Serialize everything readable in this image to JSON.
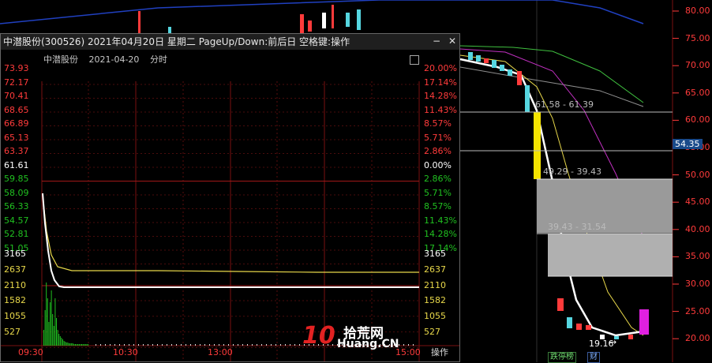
{
  "window": {
    "title": "中潜股份(300526) 2021年04月20日 星期二 PageUp/Down:前后日 空格键:操作",
    "minimize": "−",
    "close": "✕"
  },
  "intraday": {
    "name": "中潜股份",
    "date": "2021-04-20",
    "mode": "分时",
    "price_ticks": [
      "73.93",
      "72.17",
      "70.41",
      "68.65",
      "66.89",
      "65.13",
      "63.37",
      "61.61",
      "59.85",
      "58.09",
      "56.33",
      "54.57",
      "52.81",
      "51.05"
    ],
    "pct_ticks": [
      "20.00%",
      "17.14%",
      "14.28%",
      "11.43%",
      "8.57%",
      "5.71%",
      "2.86%",
      "0.00%",
      "2.86%",
      "5.71%",
      "8.57%",
      "11.43%",
      "14.28%",
      "17.14%"
    ],
    "volume_ticks": [
      "3165",
      "2637",
      "2110",
      "1582",
      "1055",
      "527"
    ],
    "time_ticks": [
      "09:30",
      "10:30",
      "13:00",
      "15:00"
    ],
    "ops_label": "操作"
  },
  "daily": {
    "price_axis": [
      "80.00",
      "75.00",
      "70.00",
      "65.00",
      "60.00",
      "55.00",
      "50.00",
      "45.00",
      "40.00",
      "35.00",
      "30.00",
      "25.00",
      "20.00"
    ],
    "current_price": "54.35",
    "zones": [
      {
        "label": "61.58 - 61.39"
      },
      {
        "label": "49.29 - 39.43"
      },
      {
        "label": "39.43 - 31.54"
      }
    ],
    "low_label": "19.16",
    "badges": [
      {
        "text": "跌停榜"
      },
      {
        "text": "财"
      }
    ]
  },
  "watermark": {
    "logo_number": "10",
    "cn": "拾荒网",
    "en": "Huang.CN"
  }
}
